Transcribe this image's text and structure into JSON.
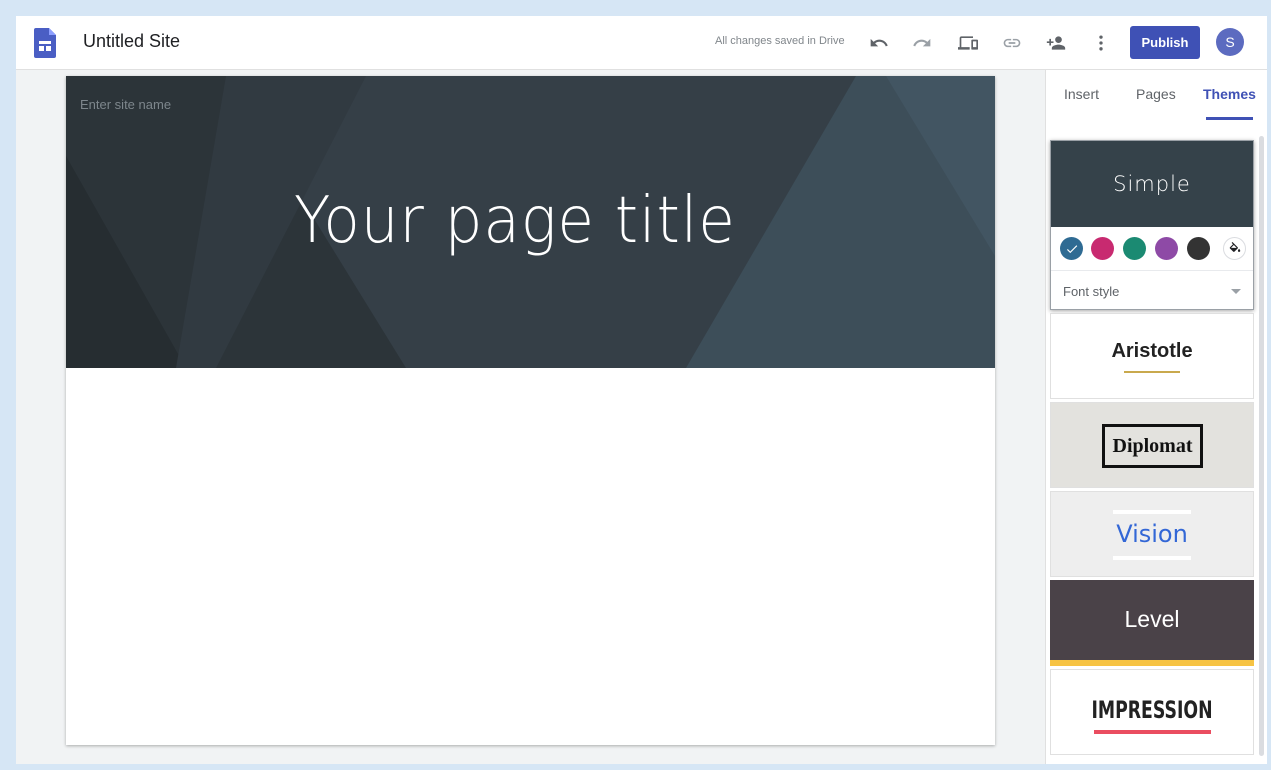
{
  "app": {
    "site_title": "Untitled Site",
    "save_status": "All changes saved in Drive",
    "publish_label": "Publish",
    "avatar_initial": "S"
  },
  "toolbar": {
    "icons": [
      "undo-icon",
      "redo-icon",
      "preview-devices-icon",
      "link-icon",
      "share-person-add-icon",
      "more-vert-icon"
    ]
  },
  "canvas": {
    "site_name_placeholder": "Enter site name",
    "page_title": "Your page title",
    "header_color": "#35424a"
  },
  "panel": {
    "tabs": [
      {
        "label": "Insert",
        "active": false
      },
      {
        "label": "Pages",
        "active": false
      },
      {
        "label": "Themes",
        "active": true
      }
    ],
    "themes": {
      "simple": {
        "name": "Simple",
        "colors": [
          "#2f6b93",
          "#c82a70",
          "#1b8a72",
          "#8e4aa6",
          "#333333"
        ],
        "selected_color": "#2f6b93",
        "font_style_label": "Font style"
      },
      "aristotle": {
        "name": "Aristotle",
        "accent": "#c9a94d"
      },
      "diplomat": {
        "name": "Diplomat"
      },
      "vision": {
        "name": "Vision",
        "accent": "#3367d6"
      },
      "level": {
        "name": "Level",
        "accent": "#f6c343"
      },
      "impression": {
        "name": "IMPRESSION",
        "accent": "#ea4d60"
      }
    }
  },
  "colors": {
    "brand_accent": "#3f51b5",
    "avatar": "#5c6bc0"
  }
}
